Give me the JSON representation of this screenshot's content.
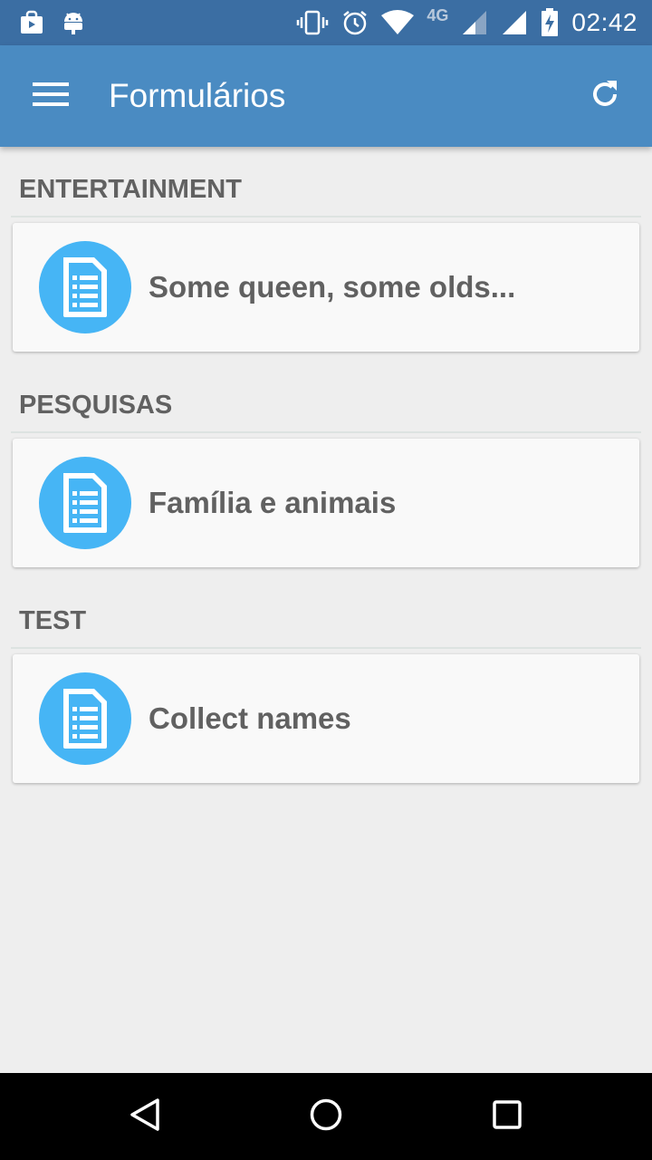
{
  "status_bar": {
    "time": "02:42",
    "network": "4G",
    "icons": [
      "shopping-bag-icon",
      "android-icon",
      "vibrate-icon",
      "alarm-icon",
      "wifi-icon",
      "signal-icon",
      "battery-charging-icon"
    ]
  },
  "app_bar": {
    "title": "Formulários",
    "menu_icon": "hamburger-menu-icon",
    "refresh_icon": "refresh-icon",
    "background": "#4a8bc2"
  },
  "sections": [
    {
      "header": "ENTERTAINMENT",
      "items": [
        {
          "label": "Some queen, some olds...",
          "icon": "form-document-icon"
        }
      ]
    },
    {
      "header": "PESQUISAS",
      "items": [
        {
          "label": "Família e animais",
          "icon": "form-document-icon"
        }
      ]
    },
    {
      "header": "TEST",
      "items": [
        {
          "label": "Collect names",
          "icon": "form-document-icon"
        }
      ]
    }
  ],
  "colors": {
    "status_bar": "#3b6ea3",
    "accent_icon": "#46b5f5",
    "text": "#616161",
    "background": "#eeeeee"
  },
  "nav_bar": {
    "icons": [
      "back-icon",
      "home-icon",
      "recents-icon"
    ]
  }
}
